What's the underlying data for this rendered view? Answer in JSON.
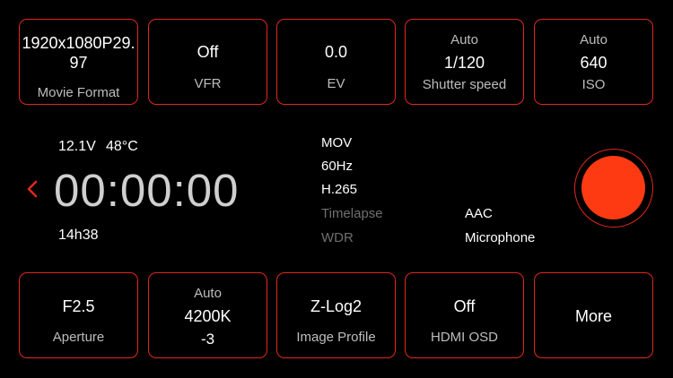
{
  "colors": {
    "accent": "#e0281c",
    "record": "#fd3a12",
    "dim_text": "#6f6f6f"
  },
  "top_row": {
    "movie_format": {
      "value": "1920x1080P29.97",
      "value_line1": "1920x1080P29.",
      "value_line2": "97",
      "label": "Movie Format"
    },
    "vfr": {
      "value": "Off",
      "label": "VFR"
    },
    "ev": {
      "value": "0.0",
      "label": "EV"
    },
    "shutter": {
      "mode": "Auto",
      "value": "1/120",
      "label": "Shutter speed"
    },
    "iso": {
      "mode": "Auto",
      "value": "640",
      "label": "ISO"
    }
  },
  "status": {
    "voltage": "12.1V",
    "temperature": "48°C",
    "timecode": "00:00:00",
    "remaining": "14h38"
  },
  "info": {
    "container": "MOV",
    "frequency": "60Hz",
    "codec": "H.265",
    "timelapse": "Timelapse",
    "wdr": "WDR",
    "audio_codec": "AAC",
    "audio_source": "Microphone"
  },
  "bottom_row": {
    "aperture": {
      "value": "F2.5",
      "label": "Aperture"
    },
    "white_balance": {
      "mode": "Auto",
      "value": "4200K",
      "tint": "-3"
    },
    "image_profile": {
      "value": "Z-Log2",
      "label": "Image Profile"
    },
    "hdmi_osd": {
      "value": "Off",
      "label": "HDMI OSD"
    },
    "more": {
      "label": "More"
    }
  },
  "icons": {
    "back": "chevron-left-icon",
    "record": "record-button-icon"
  }
}
